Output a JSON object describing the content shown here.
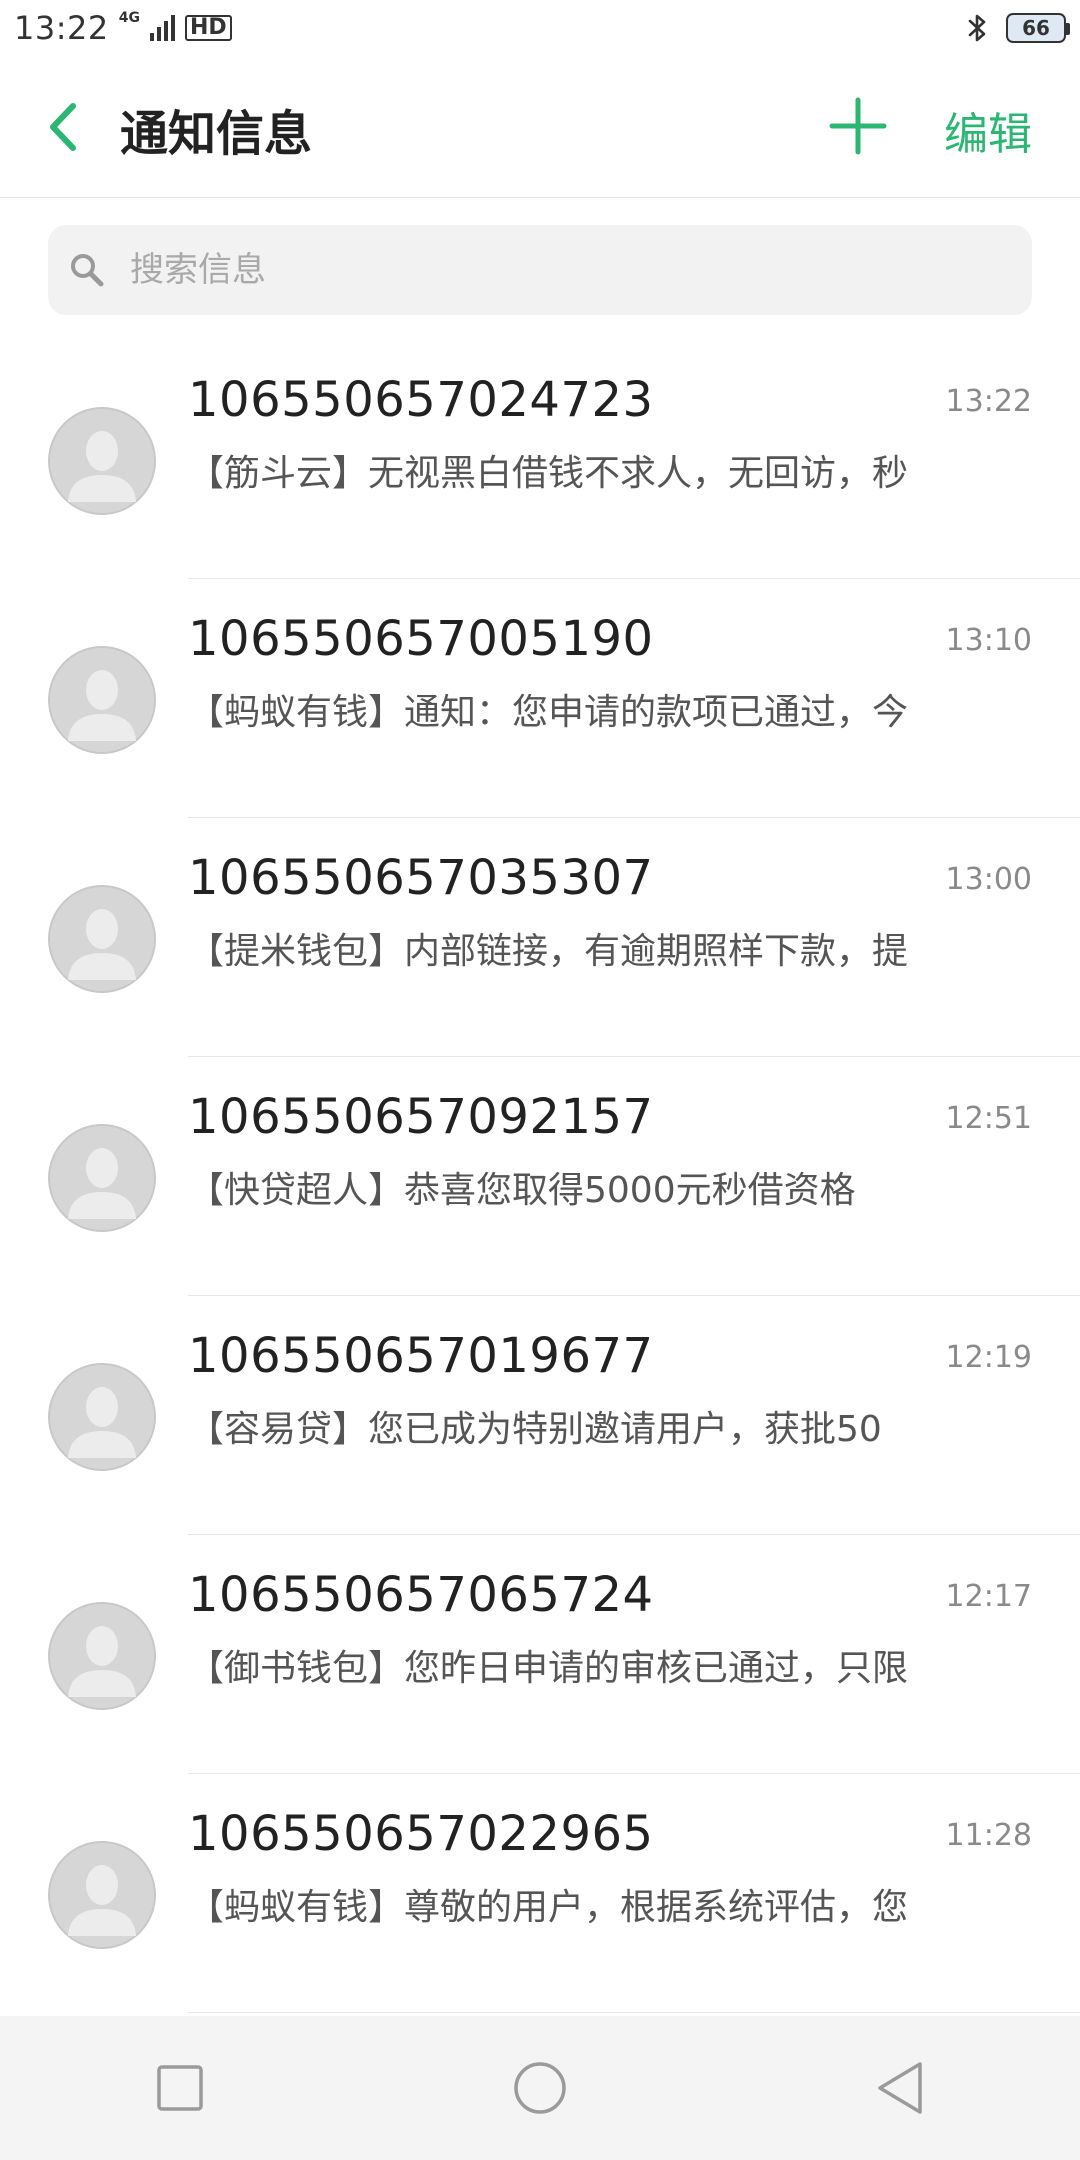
{
  "status_bar": {
    "time": "13:22",
    "network": "4G",
    "hd": "HD",
    "battery": "66",
    "icons": [
      "signal-icon",
      "hd-icon",
      "bluetooth-icon",
      "battery-icon"
    ]
  },
  "header": {
    "title": "通知信息",
    "add_icon": "plus-icon",
    "edit_label": "编辑",
    "accent_color": "#2bb673"
  },
  "search": {
    "placeholder": "搜索信息"
  },
  "messages": [
    {
      "sender": "106550657024723",
      "preview": "【筋斗云】无视黑白借钱不求人，无回访，秒",
      "time": "13:22"
    },
    {
      "sender": "106550657005190",
      "preview": "【蚂蚁有钱】通知：您申请的款项已通过，今",
      "time": "13:10"
    },
    {
      "sender": "106550657035307",
      "preview": "【提米钱包】内部链接，有逾期照样下款，提",
      "time": "13:00"
    },
    {
      "sender": "106550657092157",
      "preview": "【快贷超人】恭喜您取得5000元秒借资格",
      "time": "12:51"
    },
    {
      "sender": "106550657019677",
      "preview": "【容易贷】您已成为特别邀请用户，获批50",
      "time": "12:19"
    },
    {
      "sender": "106550657065724",
      "preview": "【御书钱包】您昨日申请的审核已通过，只限",
      "time": "12:17"
    },
    {
      "sender": "106550657022965",
      "preview": "【蚂蚁有钱】尊敬的用户，根据系统评估，您",
      "time": "11:28"
    }
  ],
  "nav": {
    "icons": [
      "square-recents-icon",
      "circle-home-icon",
      "triangle-back-icon"
    ]
  }
}
